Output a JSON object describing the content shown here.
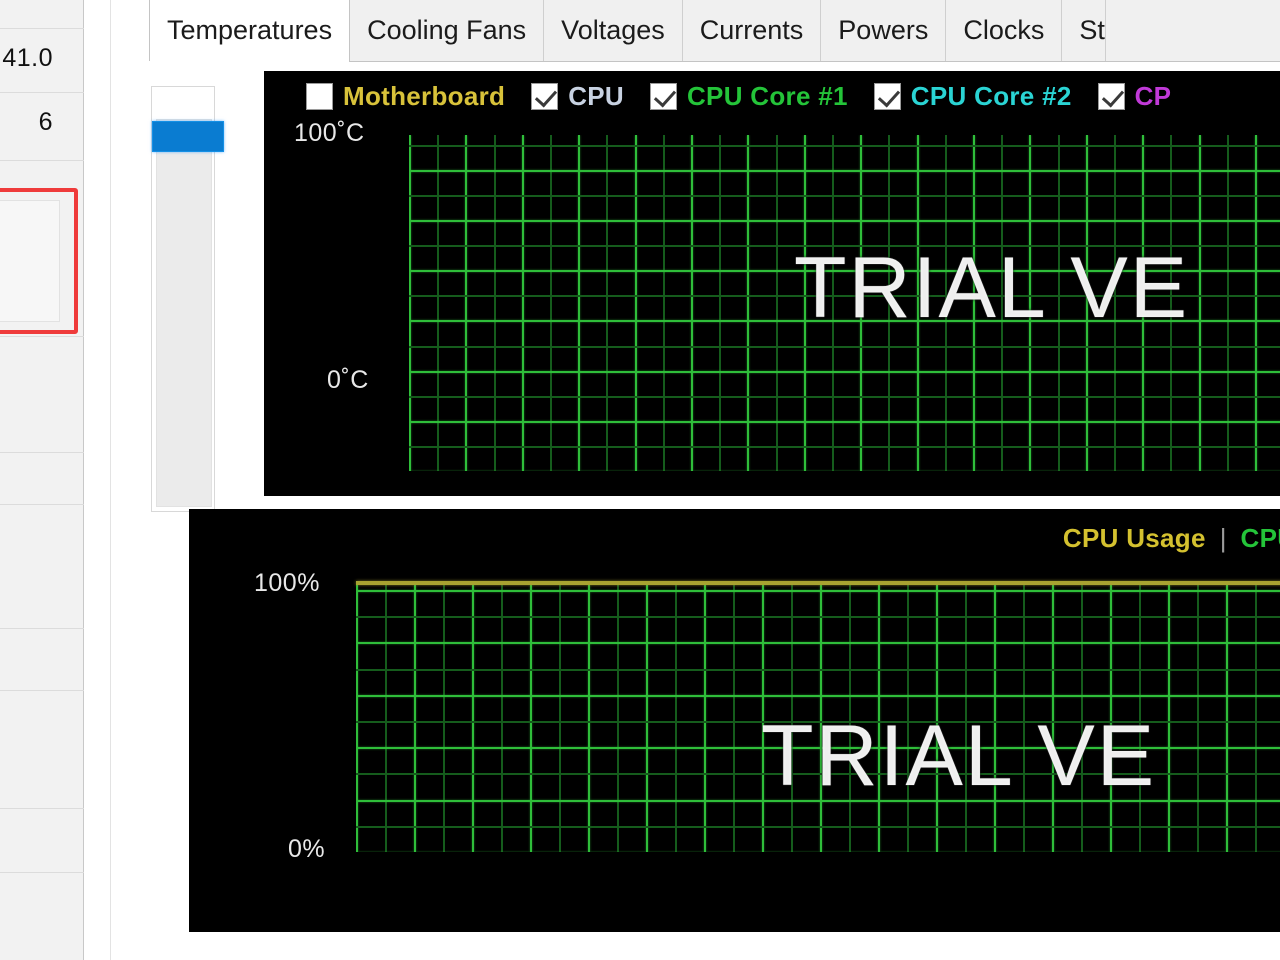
{
  "left_panel": {
    "values": [
      "41.0",
      "6"
    ],
    "highlight_color": "#ef3b3b"
  },
  "tabs": [
    {
      "label": "Temperatures",
      "active": true
    },
    {
      "label": "Cooling Fans",
      "active": false
    },
    {
      "label": "Voltages",
      "active": false
    },
    {
      "label": "Currents",
      "active": false
    },
    {
      "label": "Powers",
      "active": false
    },
    {
      "label": "Clocks",
      "active": false
    },
    {
      "label": "St",
      "active": false
    }
  ],
  "temperature_graph": {
    "watermark": "TRIAL VE",
    "y_top_label": "100˚C",
    "y_bottom_label": "0˚C",
    "grid_color_bright": "#2fbe3a",
    "grid_color_dim": "#155c1c",
    "legend": [
      {
        "label": "Motherboard",
        "checked": false,
        "color": "#d8c23a"
      },
      {
        "label": "CPU",
        "checked": true,
        "color": "#c8d2e2"
      },
      {
        "label": "CPU Core #1",
        "checked": true,
        "color": "#24c439"
      },
      {
        "label": "CPU Core #2",
        "checked": true,
        "color": "#2ad4d4"
      },
      {
        "label": "CP",
        "checked": true,
        "color": "#c13ad8"
      }
    ]
  },
  "usage_graph": {
    "watermark": "TRIAL VE",
    "y_top_label": "100%",
    "y_bottom_label": "0%",
    "header": [
      {
        "label": "CPU Usage",
        "color": "#d4c12f"
      },
      {
        "label": "CPU T",
        "color": "#24c439"
      }
    ],
    "header_separator": "|"
  },
  "chart_data": [
    {
      "type": "line",
      "title": "Temperatures",
      "ylabel": "˚C",
      "ylim": [
        0,
        100
      ],
      "ytick_labels": [
        "100˚C",
        "0˚C"
      ],
      "grid": true,
      "legend_position": "top",
      "series": [
        {
          "name": "Motherboard",
          "color": "#d8c23a",
          "visible": false,
          "values": []
        },
        {
          "name": "CPU",
          "color": "#c8d2e2",
          "visible": true,
          "values": []
        },
        {
          "name": "CPU Core #1",
          "color": "#24c439",
          "visible": true,
          "values": []
        },
        {
          "name": "CPU Core #2",
          "color": "#2ad4d4",
          "visible": true,
          "values": []
        },
        {
          "name": "CP",
          "color": "#c13ad8",
          "visible": true,
          "values": []
        }
      ],
      "annotations": [
        "TRIAL VE"
      ]
    },
    {
      "type": "line",
      "title": "CPU Usage",
      "ylabel": "%",
      "ylim": [
        0,
        100
      ],
      "ytick_labels": [
        "100%",
        "0%"
      ],
      "grid": true,
      "legend_position": "top-right",
      "series": [
        {
          "name": "CPU Usage",
          "color": "#d4c12f",
          "visible": true,
          "values": [
            100,
            100,
            100,
            100,
            100,
            100,
            100,
            100,
            100,
            100
          ]
        },
        {
          "name": "CPU T",
          "color": "#24c439",
          "visible": true,
          "values": []
        }
      ],
      "annotations": [
        "TRIAL VE"
      ]
    }
  ]
}
